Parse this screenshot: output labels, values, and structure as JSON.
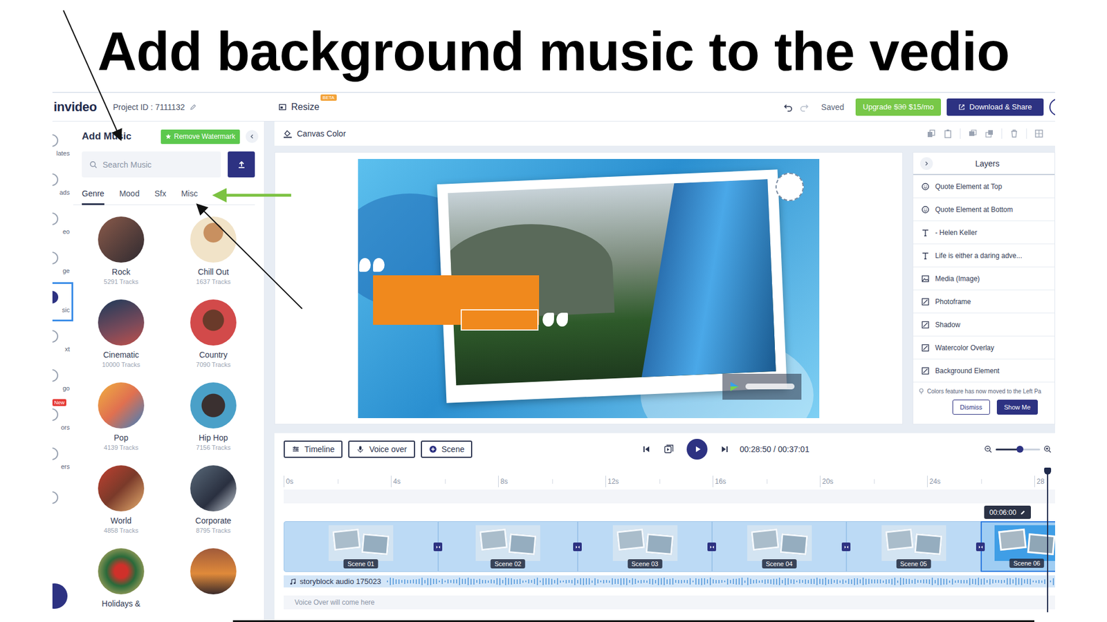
{
  "title": "Add background music to the vedio",
  "app": {
    "logo": "invideo",
    "project_id": "Project ID : 7111132",
    "resize": "Resize",
    "resize_badge": "BETA",
    "saved": "Saved",
    "upgrade": {
      "label": "Upgrade",
      "old_price": "$30",
      "price": "$15/mo"
    },
    "download": "Download & Share"
  },
  "rail": [
    {
      "label": "lates",
      "selected": false
    },
    {
      "label": "ads",
      "selected": false
    },
    {
      "label": "eo",
      "selected": false
    },
    {
      "label": "ge",
      "selected": false
    },
    {
      "label": "sic",
      "selected": true
    },
    {
      "label": "xt",
      "selected": false
    },
    {
      "label": "go",
      "selected": false
    },
    {
      "label": "ors",
      "selected": false,
      "badge": "New"
    },
    {
      "label": "ers",
      "selected": false
    }
  ],
  "music_panel": {
    "title": "Add Music",
    "watermark_button": "Remove Watermark",
    "search_placeholder": "Search Music",
    "tabs": [
      {
        "label": "Genre",
        "selected": true
      },
      {
        "label": "Mood",
        "selected": false
      },
      {
        "label": "Sfx",
        "selected": false
      },
      {
        "label": "Misc",
        "selected": false
      }
    ],
    "genres": [
      {
        "name": "Rock",
        "tracks": "5291 Tracks"
      },
      {
        "name": "Chill Out",
        "tracks": "1637 Tracks"
      },
      {
        "name": "Cinematic",
        "tracks": "10000 Tracks"
      },
      {
        "name": "Country",
        "tracks": "7090 Tracks"
      },
      {
        "name": "Pop",
        "tracks": "4139 Tracks"
      },
      {
        "name": "Hip Hop",
        "tracks": "7156 Tracks"
      },
      {
        "name": "World",
        "tracks": "4858 Tracks"
      },
      {
        "name": "Corporate",
        "tracks": "8795 Tracks"
      },
      {
        "name": "Holidays &",
        "tracks": null
      },
      {
        "name": null,
        "tracks": null
      }
    ]
  },
  "canvas_toolbar": {
    "label": "Canvas Color"
  },
  "layers": {
    "title": "Layers",
    "items": [
      {
        "label": "Quote Element at Top",
        "kind": "quote"
      },
      {
        "label": "Quote Element at Bottom",
        "kind": "quote"
      },
      {
        "label": "- Helen Keller",
        "kind": "text"
      },
      {
        "label": "Life is either a daring adve...",
        "kind": "text"
      },
      {
        "label": "Media (Image)",
        "kind": "image"
      },
      {
        "label": "Photoframe",
        "kind": "shape"
      },
      {
        "label": "Shadow",
        "kind": "shape"
      },
      {
        "label": "Watercolor Overlay",
        "kind": "shape"
      },
      {
        "label": "Background Element",
        "kind": "shape"
      }
    ],
    "notice": "Colors feature has now moved to the Left Pa",
    "buttons": [
      {
        "label": "Dismiss",
        "primary": false
      },
      {
        "label": "Show Me",
        "primary": true
      }
    ]
  },
  "timeline": {
    "buttons": [
      {
        "label": "Timeline",
        "kind": "timeline"
      },
      {
        "label": "Voice over",
        "kind": "mic"
      },
      {
        "label": "Scene",
        "kind": "add"
      }
    ],
    "time": "00:28:50 / 00:37:01",
    "zoom": {
      "level": 0.55
    },
    "ruler": [
      "0s",
      "4s",
      "8s",
      "12s",
      "16s",
      "20s",
      "24s",
      "28"
    ],
    "scenes": [
      {
        "label": "Scene 01",
        "selected": false
      },
      {
        "label": "Scene 02",
        "selected": false
      },
      {
        "label": "Scene 03",
        "selected": false
      },
      {
        "label": "Scene 04",
        "selected": false
      },
      {
        "label": "Scene 05",
        "selected": false
      },
      {
        "label": "Scene 06",
        "selected": true
      }
    ],
    "playhead_time": "00:06:00",
    "audio_track": "storyblock audio 175023",
    "voice_over_placeholder": "Voice Over will come here"
  }
}
